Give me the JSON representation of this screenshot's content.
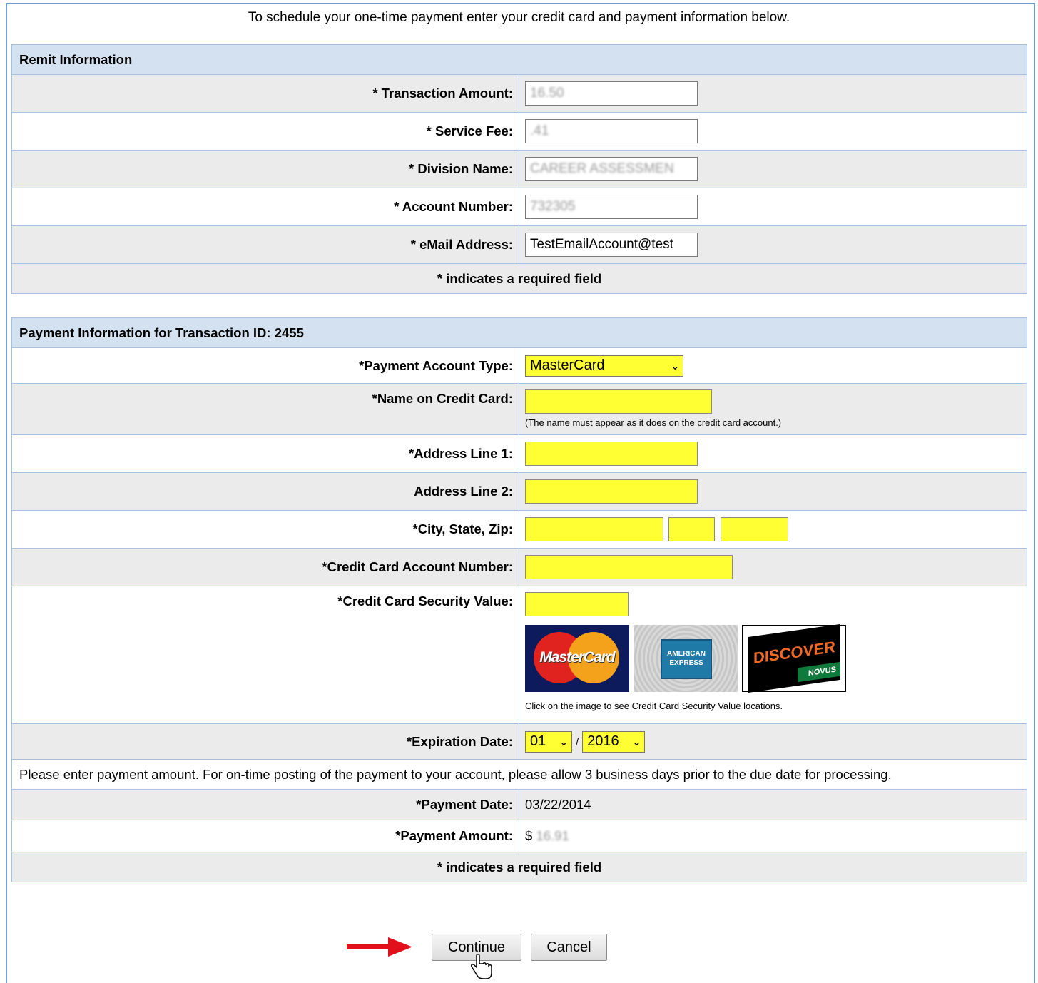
{
  "intro": "To schedule your one-time payment enter your credit card and payment information below.",
  "remit": {
    "header": "Remit Information",
    "transaction_amount_label": "* Transaction Amount:",
    "transaction_amount_value": "16.50",
    "service_fee_label": "* Service Fee:",
    "service_fee_value": ".41",
    "division_name_label": "* Division Name:",
    "division_name_value": "CAREER ASSESSMEN",
    "account_number_label": "* Account Number:",
    "account_number_value": "732305",
    "email_label": "* eMail Address:",
    "email_value": "TestEmailAccount@test",
    "required_note": "* indicates a required field"
  },
  "payment": {
    "header": "Payment Information for Transaction ID: 2455",
    "account_type_label": "*Payment Account Type:",
    "account_type_value": "MasterCard",
    "name_label": "*Name on Credit Card:",
    "name_note": "(The name must appear as it does on the credit card account.)",
    "address1_label": "*Address Line 1:",
    "address2_label": "Address Line 2:",
    "city_label": "*City, State, Zip:",
    "cc_number_label": "*Credit Card Account Number:",
    "cc_security_label": "*Credit Card Security Value:",
    "cards": {
      "mastercard": "MasterCard",
      "amex_line1": "AMERICAN",
      "amex_line2": "EXPRESS",
      "discover": "DISCOVER",
      "novus": "NOVUS"
    },
    "card_note": "Click on the image to see Credit Card Security Value locations.",
    "expiration_label": "*Expiration Date:",
    "exp_month": "01",
    "exp_separator": "/",
    "exp_year": "2016",
    "amount_note": "Please enter payment amount. For on-time posting of the payment to your account, please allow 3 business days prior to the due date for processing.",
    "payment_date_label": "*Payment Date:",
    "payment_date_value": "03/22/2014",
    "payment_amount_label": "*Payment Amount:",
    "currency": "$",
    "payment_amount_value": "16.91",
    "required_note": "* indicates a required field"
  },
  "buttons": {
    "continue": "Continue",
    "cancel": "Cancel"
  },
  "colors": {
    "section_header": "#d3e1f0",
    "row_gray": "#ebebeb",
    "field_yellow": "#ffff33",
    "arrow": "#e2101a"
  }
}
